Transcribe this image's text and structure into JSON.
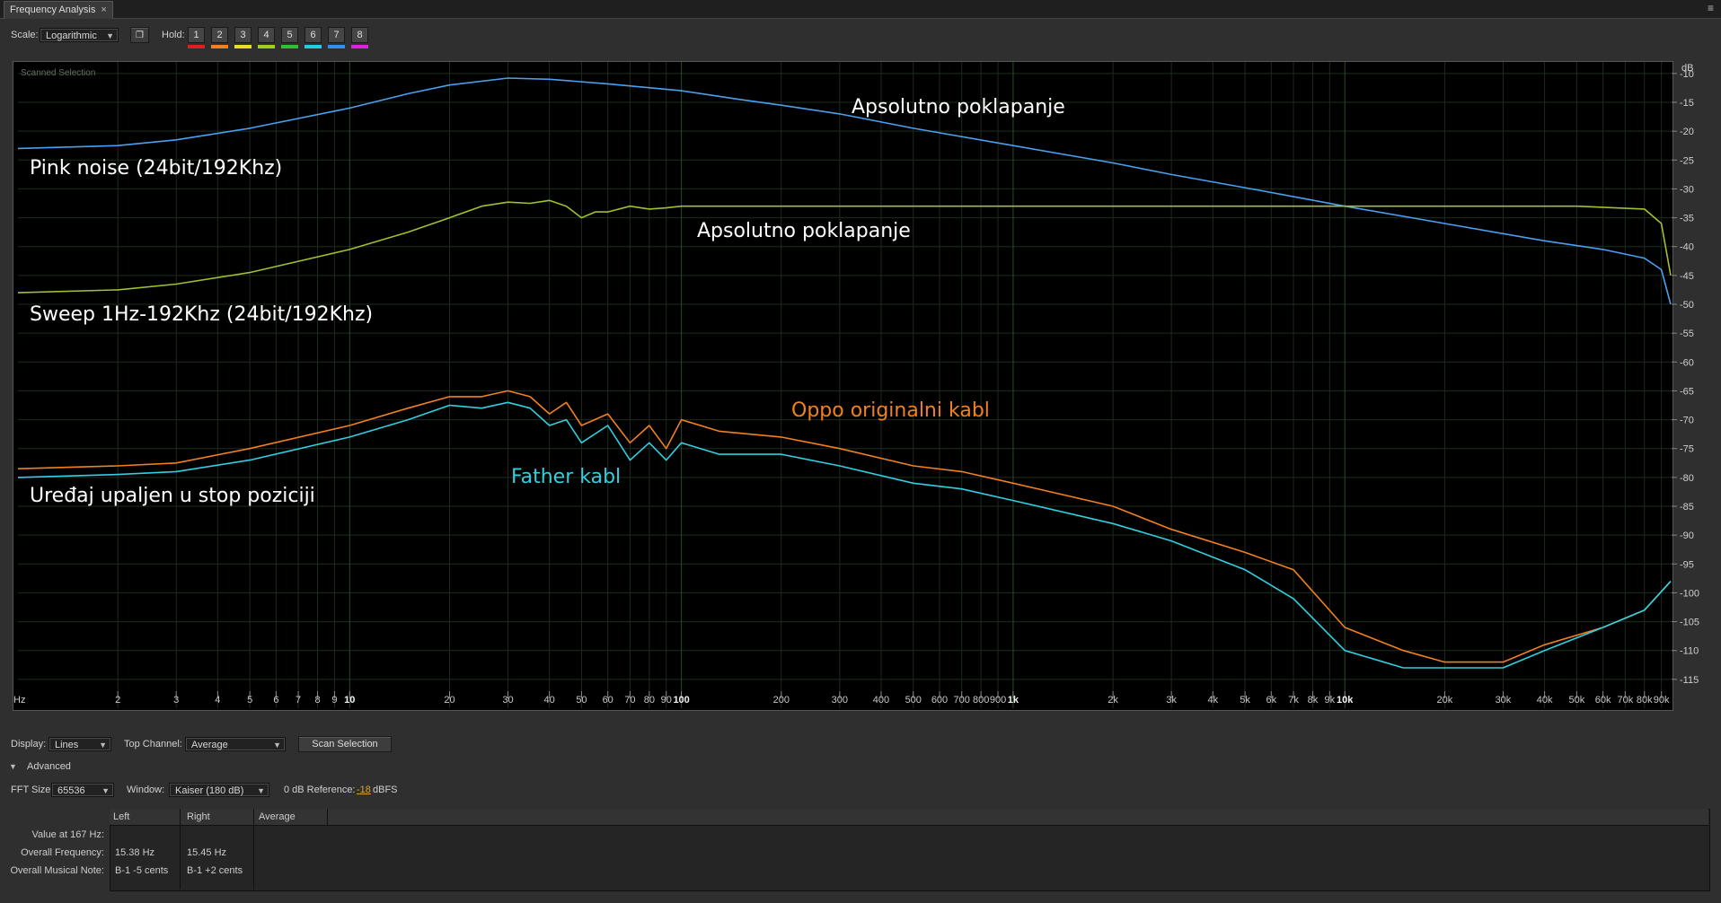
{
  "window": {
    "tab_title": "Frequency Analysis",
    "tab_close": "×",
    "panel_menu": "≡"
  },
  "toolbar": {
    "scale_label": "Scale:",
    "scale_value": "Logarithmic",
    "hold_label": "Hold:",
    "holds": [
      {
        "label": "1",
        "color": "#e02020"
      },
      {
        "label": "2",
        "color": "#f08020"
      },
      {
        "label": "3",
        "color": "#e8e020"
      },
      {
        "label": "4",
        "color": "#a0d020"
      },
      {
        "label": "5",
        "color": "#30c030"
      },
      {
        "label": "6",
        "color": "#20d0e0"
      },
      {
        "label": "7",
        "color": "#3090f0"
      },
      {
        "label": "8",
        "color": "#e020e0"
      }
    ]
  },
  "plot": {
    "corner_label": "Scanned Selection",
    "y_unit": "dB",
    "y_ticks": [
      "-10",
      "-15",
      "-20",
      "-25",
      "-30",
      "-35",
      "-40",
      "-45",
      "-50",
      "-55",
      "-60",
      "-65",
      "-70",
      "-75",
      "-80",
      "-85",
      "-90",
      "-95",
      "-100",
      "-105",
      "-110",
      "-115"
    ],
    "x_unit": "Hz",
    "x_ticks": [
      {
        "f": 2,
        "label": "2"
      },
      {
        "f": 3,
        "label": "3"
      },
      {
        "f": 4,
        "label": "4"
      },
      {
        "f": 5,
        "label": "5"
      },
      {
        "f": 6,
        "label": "6"
      },
      {
        "f": 7,
        "label": "7"
      },
      {
        "f": 8,
        "label": "8"
      },
      {
        "f": 9,
        "label": "9"
      },
      {
        "f": 10,
        "label": "10",
        "major": true
      },
      {
        "f": 20,
        "label": "20"
      },
      {
        "f": 30,
        "label": "30"
      },
      {
        "f": 40,
        "label": "40"
      },
      {
        "f": 50,
        "label": "50"
      },
      {
        "f": 60,
        "label": "60"
      },
      {
        "f": 70,
        "label": "70"
      },
      {
        "f": 80,
        "label": "80"
      },
      {
        "f": 90,
        "label": "90"
      },
      {
        "f": 100,
        "label": "100",
        "major": true
      },
      {
        "f": 200,
        "label": "200"
      },
      {
        "f": 300,
        "label": "300"
      },
      {
        "f": 400,
        "label": "400"
      },
      {
        "f": 500,
        "label": "500"
      },
      {
        "f": 600,
        "label": "600"
      },
      {
        "f": 700,
        "label": "700"
      },
      {
        "f": 800,
        "label": "800"
      },
      {
        "f": 900,
        "label": "900"
      },
      {
        "f": 1000,
        "label": "1k",
        "major": true
      },
      {
        "f": 2000,
        "label": "2k"
      },
      {
        "f": 3000,
        "label": "3k"
      },
      {
        "f": 4000,
        "label": "4k"
      },
      {
        "f": 5000,
        "label": "5k"
      },
      {
        "f": 6000,
        "label": "6k"
      },
      {
        "f": 7000,
        "label": "7k"
      },
      {
        "f": 8000,
        "label": "8k"
      },
      {
        "f": 9000,
        "label": "9k"
      },
      {
        "f": 10000,
        "label": "10k",
        "major": true
      },
      {
        "f": 20000,
        "label": "20k"
      },
      {
        "f": 30000,
        "label": "30k"
      },
      {
        "f": 40000,
        "label": "40k"
      },
      {
        "f": 50000,
        "label": "50k"
      },
      {
        "f": 60000,
        "label": "60k"
      },
      {
        "f": 70000,
        "label": "70k"
      },
      {
        "f": 80000,
        "label": "80k"
      },
      {
        "f": 90000,
        "label": "90k"
      }
    ],
    "annotations": [
      {
        "name": "annotation-pink-noise",
        "text": "Pink noise (24bit/192Khz)",
        "color": "#ffffff"
      },
      {
        "name": "annotation-match-1",
        "text": "Apsolutno poklapanje",
        "color": "#ffffff"
      },
      {
        "name": "annotation-match-2",
        "text": "Apsolutno poklapanje",
        "color": "#ffffff"
      },
      {
        "name": "annotation-sweep",
        "text": "Sweep 1Hz-192Khz (24bit/192Khz)",
        "color": "#ffffff"
      },
      {
        "name": "annotation-oppo",
        "text": "Oppo originalni kabl",
        "color": "#f08020"
      },
      {
        "name": "annotation-father",
        "text": "Father kabl",
        "color": "#30d0e0"
      },
      {
        "name": "annotation-stop",
        "text": "Uređaj upaljen u stop poziciji",
        "color": "#ffffff"
      }
    ]
  },
  "chart_data": {
    "type": "line",
    "x_scale": "log",
    "xlim": [
      1,
      96000
    ],
    "ylim": [
      -120,
      -8
    ],
    "grid": true,
    "series": [
      {
        "color": "#4aa0f0",
        "x": [
          1,
          2,
          3,
          5,
          10,
          15,
          20,
          30,
          40,
          60,
          100,
          150,
          200,
          300,
          500,
          1000,
          2000,
          3000,
          5000,
          10000,
          20000,
          40000,
          60000,
          80000,
          90000,
          96000
        ],
        "y": [
          -23,
          -22.5,
          -21.5,
          -19.5,
          -16,
          -13.5,
          -12,
          -10.8,
          -11,
          -11.8,
          -13,
          -14.5,
          -15.5,
          -17,
          -19.5,
          -22.5,
          -25.5,
          -27.5,
          -29.8,
          -33,
          -36,
          -39,
          -40.5,
          -42,
          -44,
          -50
        ]
      },
      {
        "color": "#a0c030",
        "x": [
          1,
          2,
          3,
          5,
          10,
          15,
          20,
          25,
          30,
          35,
          40,
          45,
          50,
          55,
          60,
          70,
          80,
          90,
          100,
          150,
          200,
          500,
          1000,
          5000,
          10000,
          50000,
          80000,
          90000,
          96000
        ],
        "y": [
          -48,
          -47.5,
          -46.5,
          -44.5,
          -40.5,
          -37.5,
          -35,
          -33,
          -32.3,
          -32.5,
          -32,
          -33,
          -35,
          -34,
          -34,
          -33,
          -33.5,
          -33.3,
          -33,
          -33,
          -33,
          -33,
          -33,
          -33,
          -33,
          -33,
          -33.5,
          -36,
          -45
        ]
      },
      {
        "color": "#f08020",
        "x": [
          1,
          2,
          3,
          5,
          10,
          15,
          20,
          25,
          30,
          35,
          40,
          45,
          50,
          60,
          70,
          80,
          90,
          100,
          130,
          200,
          300,
          500,
          700,
          1000,
          2000,
          3000,
          5000,
          7000,
          10000,
          15000,
          20000,
          30000,
          40000,
          60000,
          80000,
          96000
        ],
        "y": [
          -78.5,
          -78,
          -77.5,
          -75,
          -71,
          -68,
          -66,
          -66,
          -65,
          -66,
          -69,
          -67,
          -71,
          -69,
          -74,
          -71,
          -75,
          -70,
          -72,
          -73,
          -75,
          -78,
          -79,
          -81,
          -85,
          -89,
          -93,
          -96,
          -106,
          -110,
          -112,
          -112,
          -109,
          -106,
          -103,
          -98
        ]
      },
      {
        "color": "#30d0e0",
        "x": [
          1,
          2,
          3,
          5,
          10,
          15,
          20,
          25,
          30,
          35,
          40,
          45,
          50,
          60,
          70,
          80,
          90,
          100,
          130,
          200,
          300,
          500,
          700,
          1000,
          2000,
          3000,
          5000,
          7000,
          10000,
          15000,
          20000,
          30000,
          40000,
          60000,
          80000,
          96000
        ],
        "y": [
          -80,
          -79.5,
          -79,
          -77,
          -73,
          -70,
          -67.5,
          -68,
          -67,
          -68,
          -71,
          -70,
          -74,
          -71,
          -77,
          -74,
          -77,
          -74,
          -76,
          -76,
          -78,
          -81,
          -82,
          -84,
          -88,
          -91,
          -96,
          -101,
          -110,
          -113,
          -113,
          -113,
          -110,
          -106,
          -103,
          -98
        ]
      }
    ]
  },
  "bottom": {
    "display_label": "Display:",
    "display_value": "Lines",
    "top_channel_label": "Top Channel:",
    "top_channel_value": "Average",
    "scan_button": "Scan Selection",
    "advanced_label": "Advanced",
    "fft_label": "FFT Size:",
    "fft_value": "65536",
    "window_label": "Window:",
    "window_value": "Kaiser (180 dB)",
    "ref_label": "0 dB Reference:",
    "ref_value": "-18",
    "ref_unit": "dBFS"
  },
  "table": {
    "columns": [
      "Left",
      "Right",
      "Average"
    ],
    "rows": [
      {
        "label": "Value at 167 Hz:",
        "left": "",
        "right": ""
      },
      {
        "label": "Overall Frequency:",
        "left": "15.38 Hz",
        "right": "15.45 Hz"
      },
      {
        "label": "Overall Musical Note:",
        "left": "B-1 -5 cents",
        "right": "B-1 +2 cents"
      }
    ]
  }
}
